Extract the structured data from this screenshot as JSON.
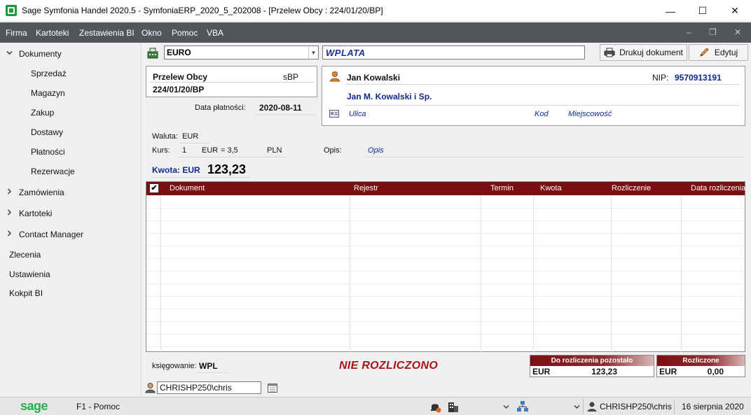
{
  "window": {
    "title": "Sage Symfonia Handel 2020.5 - SymfoniaERP_2020_5_202008 - [Przelew Obcy : 224/01/20/BP]",
    "minimize": "—",
    "maximize": "☐",
    "close": "✕"
  },
  "menu": {
    "items": [
      "Firma",
      "Kartoteki",
      "Zestawienia BI",
      "Okno",
      "Pomoc",
      "VBA"
    ],
    "mdi_minimize": "–",
    "mdi_restore": "❐",
    "mdi_close": "✕"
  },
  "sidebar": {
    "dokumenty": "Dokumenty",
    "sub": [
      "Sprzedaż",
      "Magazyn",
      "Zakup",
      "Dostawy",
      "Płatności",
      "Rezerwacje"
    ],
    "zamowienia": "Zamówienia",
    "kartoteki": "Kartoteki",
    "contact_manager": "Contact Manager",
    "zlecenia": "Zlecenia",
    "ustawienia": "Ustawienia",
    "kokpit": "Kokpit BI"
  },
  "toolbar": {
    "currency": "EURO",
    "doc_kind": "WPLATA",
    "print_label": "Drukuj dokument",
    "edit_label": "Edytuj"
  },
  "document": {
    "name": "Przelew Obcy",
    "code": "sBP",
    "number": "224/01/20/BP",
    "pay_date_label": "Data płatności:",
    "pay_date": "2020-08-11"
  },
  "client": {
    "name": "Jan Kowalski",
    "nip_label": "NIP:",
    "nip": "9570913191",
    "company": "Jan M. Kowalski i Sp.",
    "street": "Ulica",
    "postal": "Kod",
    "city": "Miejscowość"
  },
  "info": {
    "waluta_label": "Waluta:",
    "waluta": "EUR",
    "kurs_label": "Kurs:",
    "kurs_qty": "1",
    "kurs_cur": "EUR",
    "kurs_rate": "= 3,5",
    "kurs_pln": "PLN",
    "opis_label": "Opis:",
    "opis": "Opis",
    "kwota_label": "Kwota:",
    "kwota_cur": "EUR",
    "kwota": "123,23"
  },
  "table": {
    "check": "✔",
    "columns": [
      "Dokument",
      "Rejestr",
      "Termin",
      "Kwota",
      "Rozliczenie",
      "Data rozliczenia"
    ]
  },
  "footer": {
    "booking_label": "księgowanie:",
    "booking": "WPL",
    "status": "NIE ROZLICZONO",
    "remaining_label": "Do rozliczenia pozostało",
    "remaining_cur": "EUR",
    "remaining": "123,23",
    "settled_label": "Rozliczone",
    "settled_cur": "EUR",
    "settled": "0,00",
    "user": "CHRISHP250\\chris"
  },
  "statusbar": {
    "logo": "sage",
    "help": "F1 - Pomoc",
    "user": "CHRISHP250\\chris",
    "date": "16 sierpnia 2020"
  },
  "colors": {
    "header_red": "#7a0f12",
    "accent_blue": "#0f2a8c",
    "status_red": "#a8141a",
    "sage_green": "#22b14c"
  }
}
